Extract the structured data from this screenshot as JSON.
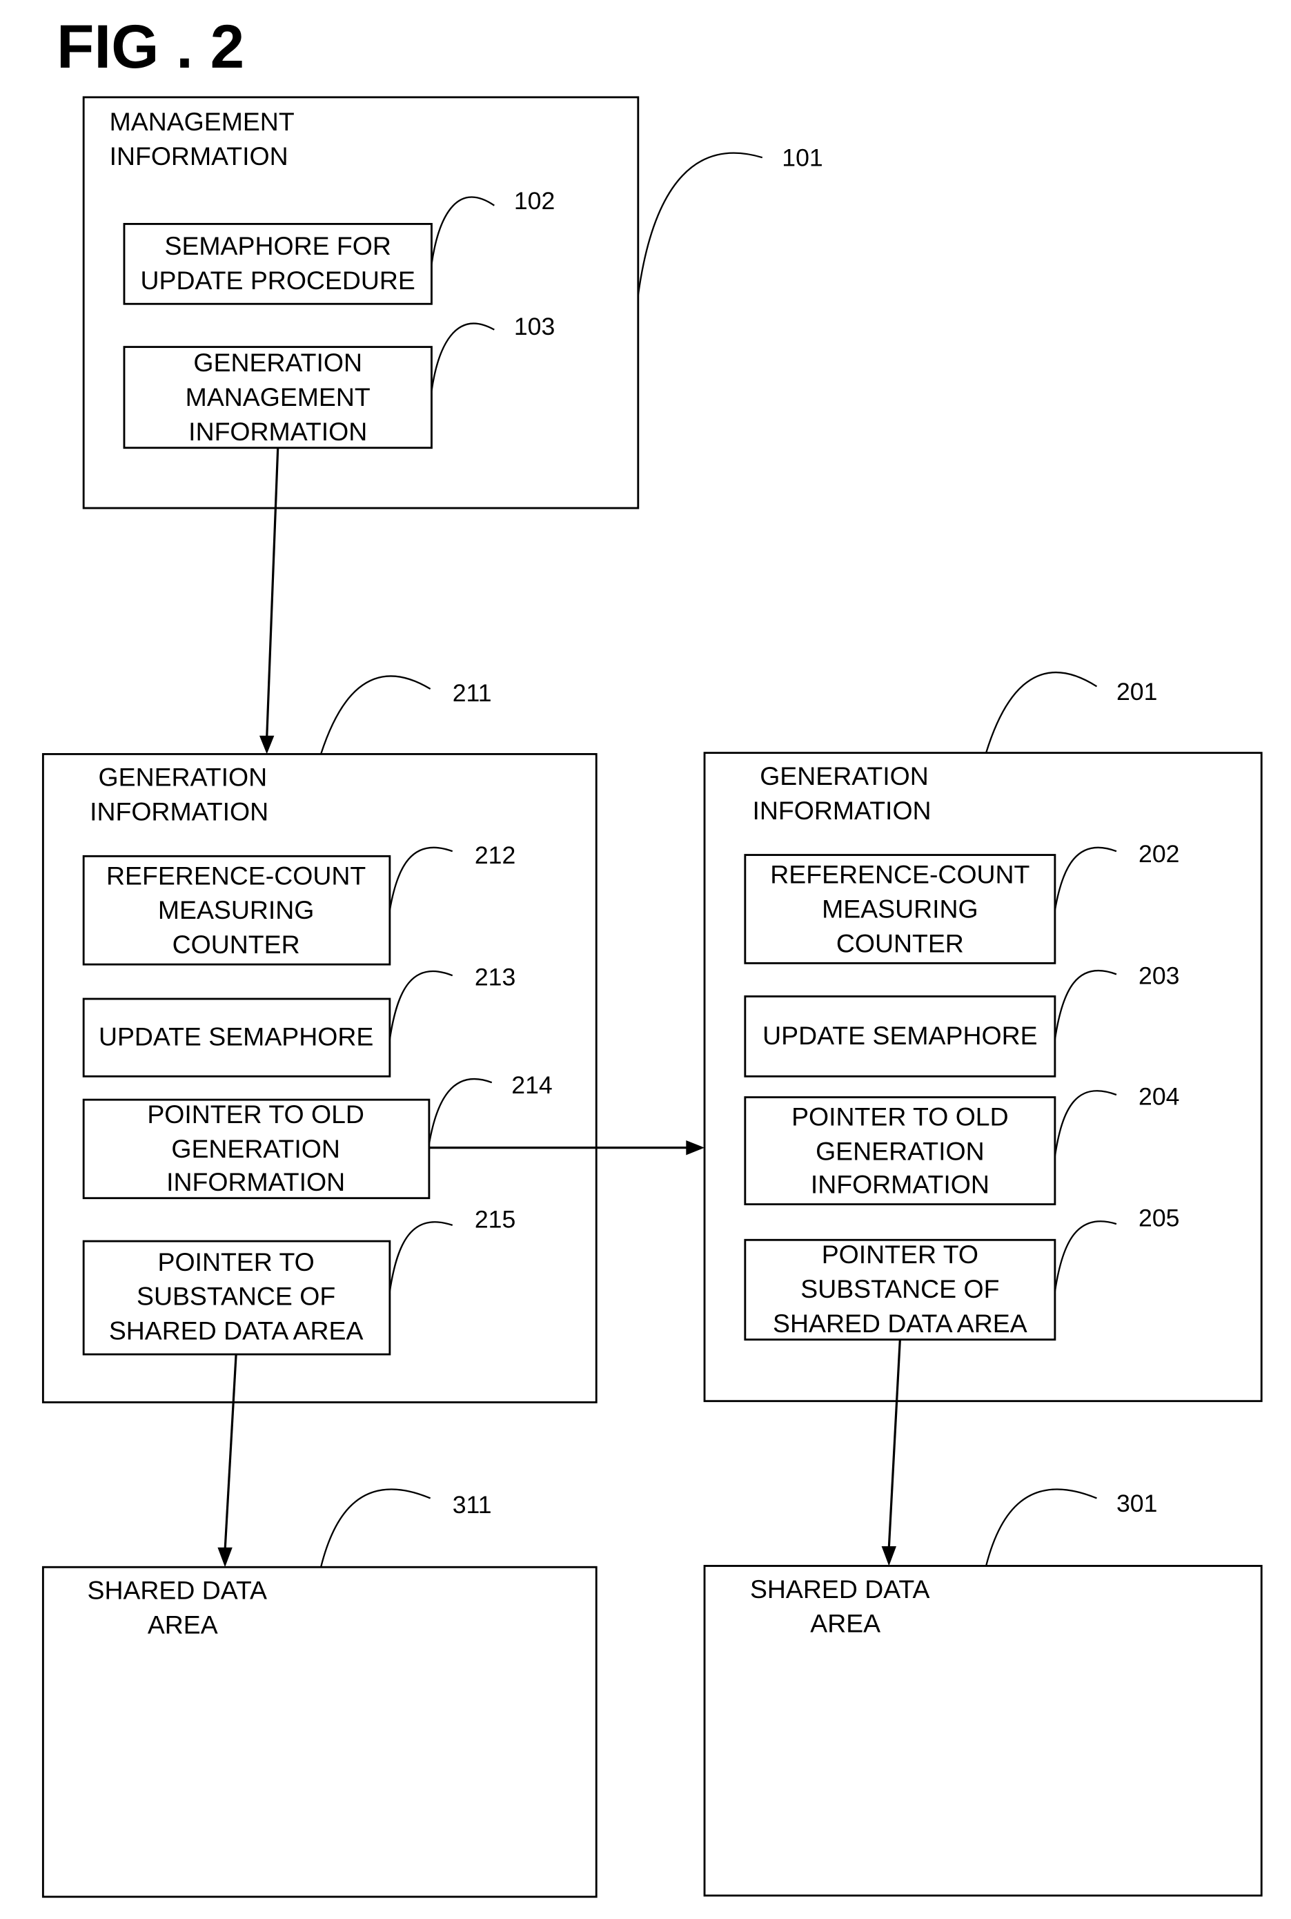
{
  "figure": {
    "title": "FIG . 2"
  },
  "management": {
    "ref": "101",
    "label": [
      "MANAGEMENT",
      "INFORMATION"
    ],
    "semaphore": {
      "ref": "102",
      "label": [
        "SEMAPHORE FOR",
        "UPDATE PROCEDURE"
      ]
    },
    "generation_management": {
      "ref": "103",
      "label": [
        "GENERATION",
        "MANAGEMENT",
        "INFORMATION"
      ]
    }
  },
  "generation_new": {
    "ref": "211",
    "label": [
      "GENERATION",
      "INFORMATION"
    ],
    "counter": {
      "ref": "212",
      "label": [
        "REFERENCE-COUNT",
        "MEASURING",
        "COUNTER"
      ]
    },
    "semaphore": {
      "ref": "213",
      "label": [
        "UPDATE SEMAPHORE"
      ]
    },
    "old_pointer": {
      "ref": "214",
      "label": [
        "POINTER TO OLD",
        "GENERATION",
        "INFORMATION"
      ]
    },
    "data_pointer": {
      "ref": "215",
      "label": [
        "POINTER TO",
        "SUBSTANCE OF",
        "SHARED DATA AREA"
      ]
    }
  },
  "generation_old": {
    "ref": "201",
    "label": [
      "GENERATION",
      "INFORMATION"
    ],
    "counter": {
      "ref": "202",
      "label": [
        "REFERENCE-COUNT",
        "MEASURING",
        "COUNTER"
      ]
    },
    "semaphore": {
      "ref": "203",
      "label": [
        "UPDATE SEMAPHORE"
      ]
    },
    "old_pointer": {
      "ref": "204",
      "label": [
        "POINTER TO OLD",
        "GENERATION",
        "INFORMATION"
      ]
    },
    "data_pointer": {
      "ref": "205",
      "label": [
        "POINTER TO",
        "SUBSTANCE OF",
        "SHARED DATA AREA"
      ]
    }
  },
  "shared_new": {
    "ref": "311",
    "label": [
      "SHARED DATA",
      "AREA"
    ]
  },
  "shared_old": {
    "ref": "301",
    "label": [
      "SHARED DATA",
      "AREA"
    ]
  }
}
